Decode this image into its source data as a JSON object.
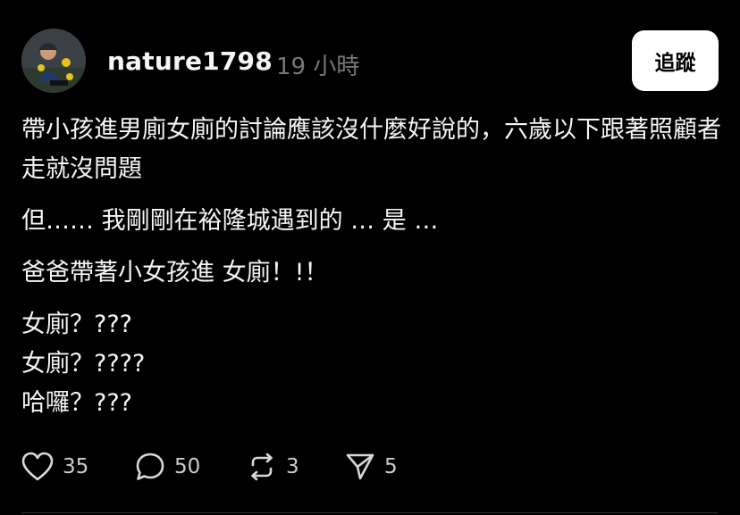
{
  "post": {
    "author": {
      "username": "nature1798",
      "timestamp": "19 小時"
    },
    "follow_label": "追蹤",
    "paragraphs": [
      "帶小孩進男廁女廁的討論應該沒什麼好說的，六歲以下跟著照顧者走就沒問題",
      "但…… 我剛剛在裕隆城遇到的 … 是 …",
      "爸爸帶著小女孩進 女廁！!！",
      "女廁？???",
      "女廁？????",
      "哈囉？???"
    ],
    "actions": {
      "likes": "35",
      "comments": "50",
      "reposts": "3",
      "shares": "5"
    }
  },
  "icons": {
    "like": "heart-icon",
    "comment": "comment-bubble-icon",
    "repost": "repost-icon",
    "share": "send-icon"
  },
  "colors": {
    "background": "#000000",
    "text": "#f3f5f7",
    "muted": "#777777",
    "follow_button_bg": "#ffffff"
  }
}
